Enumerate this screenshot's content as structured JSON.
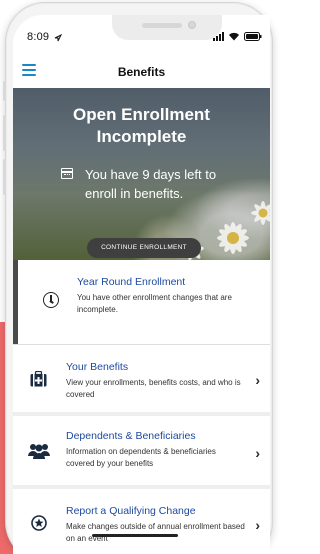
{
  "status": {
    "time": "8:09"
  },
  "header": {
    "title": "Benefits",
    "menu_icon": "hamburger-menu-icon"
  },
  "hero": {
    "title_line1": "Open Enrollment",
    "title_line2": "Incomplete",
    "message": "You have 9 days left to enroll in benefits.",
    "button": "CONTINUE ENROLLMENT",
    "icon": "calendar-icon"
  },
  "items": [
    {
      "title": "Year Round Enrollment",
      "subtitle": "You have other enrollment changes that are incomplete.",
      "icon": "clock-icon"
    },
    {
      "title": "Your Benefits",
      "subtitle": "View your enrollments, benefits costs, and who is covered",
      "icon": "medical-kit-icon"
    },
    {
      "title": "Dependents & Beneficiaries",
      "subtitle": "Information on dependents & beneficiaries covered by your benefits",
      "icon": "people-icon"
    },
    {
      "title": "Report a Qualifying Change",
      "subtitle": "Make changes outside of annual enrollment based on an event",
      "icon": "badge-star-icon"
    }
  ],
  "colors": {
    "accent": "#1b87c9",
    "link": "#1f4aa0",
    "background_stripe": "#ee6a6a"
  }
}
